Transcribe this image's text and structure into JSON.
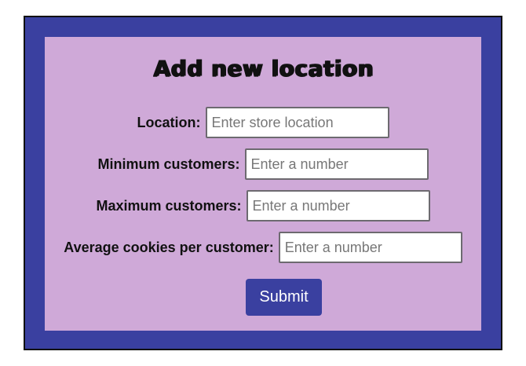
{
  "form": {
    "title": "Add new location",
    "fields": [
      {
        "label": "Location:",
        "placeholder": "Enter store location",
        "value": ""
      },
      {
        "label": "Minimum customers:",
        "placeholder": "Enter a number",
        "value": ""
      },
      {
        "label": "Maximum customers:",
        "placeholder": "Enter a number",
        "value": ""
      },
      {
        "label": "Average cookies per customer:",
        "placeholder": "Enter a number",
        "value": ""
      }
    ],
    "submit_label": "Submit"
  },
  "colors": {
    "frame": "#3a40a0",
    "panel": "#cfa9d8",
    "button": "#3a40a0",
    "button_text": "#ffffff"
  }
}
